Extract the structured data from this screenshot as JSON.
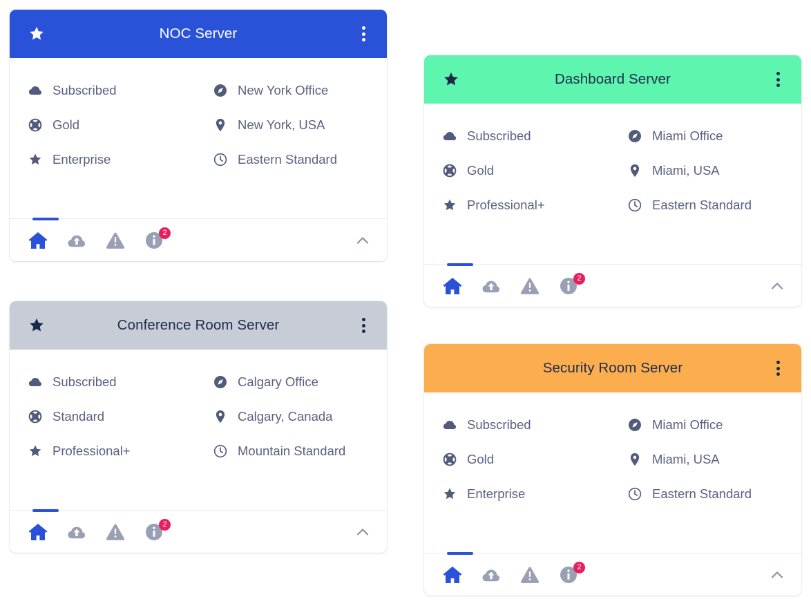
{
  "theme": {
    "blue": "#2A52D8",
    "green": "#5EF5AE",
    "gray": "#C8CCD6",
    "orange": "#FCAD4E",
    "badge_red": "#E91E5C",
    "body_text": "#5a6180",
    "icon_gray": "#8a90a6",
    "page_background": "#FFFFFF"
  },
  "footer": {
    "badge_count": "2",
    "icons": [
      {
        "name": "home-icon",
        "label": "Home",
        "active": true
      },
      {
        "name": "cloud-upload-icon",
        "label": "Cloud Upload",
        "active": false
      },
      {
        "name": "warning-icon",
        "label": "Warning",
        "active": false
      },
      {
        "name": "info-icon",
        "label": "Info",
        "active": false,
        "badge": "2"
      }
    ],
    "collapse_label": "Collapse"
  },
  "cards": [
    {
      "id": "noc-server",
      "title": "NOC Server",
      "header_color": "#2A52D8",
      "header_theme": "blue",
      "starred": true,
      "menu_label": "More options",
      "rows": [
        {
          "left_icon": "cloud-icon",
          "left_text": "Subscribed",
          "right_icon": "compass-icon",
          "right_text": "New York Office"
        },
        {
          "left_icon": "lifebuoy-icon",
          "left_text": "Gold",
          "right_icon": "map-pin-icon",
          "right_text": "New York, USA"
        },
        {
          "left_icon": "star-icon",
          "left_text": "Enterprise",
          "right_icon": "clock-icon",
          "right_text": "Eastern Standard"
        }
      ]
    },
    {
      "id": "dashboard-server",
      "title": "Dashboard Server",
      "header_color": "#5EF5AE",
      "header_theme": "green",
      "starred": true,
      "menu_label": "More options",
      "rows": [
        {
          "left_icon": "cloud-icon",
          "left_text": "Subscribed",
          "right_icon": "compass-icon",
          "right_text": "Miami Office"
        },
        {
          "left_icon": "lifebuoy-icon",
          "left_text": "Gold",
          "right_icon": "map-pin-icon",
          "right_text": "Miami, USA"
        },
        {
          "left_icon": "star-icon",
          "left_text": "Professional+",
          "right_icon": "clock-icon",
          "right_text": "Eastern Standard"
        }
      ]
    },
    {
      "id": "conference-room-server",
      "title": "Conference Room Server",
      "header_color": "#C8CCD6",
      "header_theme": "gray",
      "starred": true,
      "menu_label": "More options",
      "rows": [
        {
          "left_icon": "cloud-icon",
          "left_text": "Subscribed",
          "right_icon": "compass-icon",
          "right_text": "Calgary Office"
        },
        {
          "left_icon": "lifebuoy-icon",
          "left_text": "Standard",
          "right_icon": "map-pin-icon",
          "right_text": "Calgary, Canada"
        },
        {
          "left_icon": "star-icon",
          "left_text": "Professional+",
          "right_icon": "clock-icon",
          "right_text": "Mountain Standard"
        }
      ]
    },
    {
      "id": "security-room-server",
      "title": "Security Room Server",
      "header_color": "#FCAD4E",
      "header_theme": "orange",
      "starred": false,
      "menu_label": "More options",
      "rows": [
        {
          "left_icon": "cloud-icon",
          "left_text": "Subscribed",
          "right_icon": "compass-icon",
          "right_text": "Miami Office"
        },
        {
          "left_icon": "lifebuoy-icon",
          "left_text": "Gold",
          "right_icon": "map-pin-icon",
          "right_text": "Miami, USA"
        },
        {
          "left_icon": "star-icon",
          "left_text": "Enterprise",
          "right_icon": "clock-icon",
          "right_text": "Eastern Standard"
        }
      ]
    }
  ]
}
